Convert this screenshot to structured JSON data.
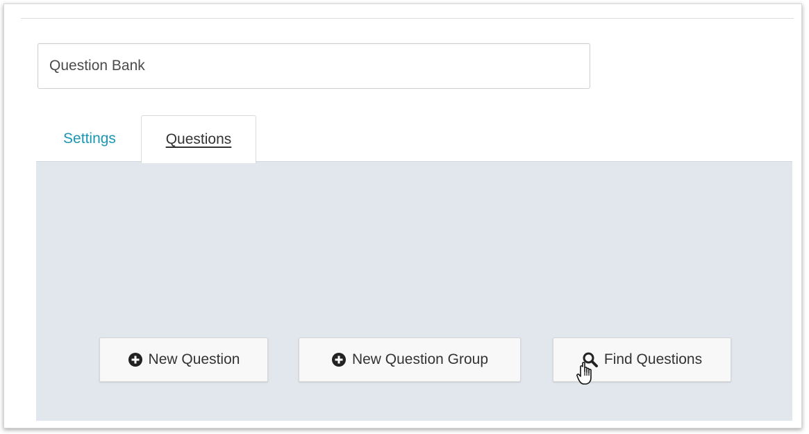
{
  "form": {
    "title_value": "Question Bank"
  },
  "tabs": [
    {
      "label": "Settings",
      "active": false
    },
    {
      "label": "Questions",
      "active": true
    }
  ],
  "actions": {
    "new_question_label": "New Question",
    "new_question_group_label": "New Question Group",
    "find_questions_label": "Find Questions"
  },
  "icons": {
    "new_question": "plus-circle-icon",
    "new_question_group": "plus-circle-icon",
    "find_questions": "search-icon",
    "pointer": "hand-pointer-cursor-icon"
  },
  "colors": {
    "tab_link": "#1a96b4",
    "panel_background": "#e1e7ed",
    "button_background": "#f8f8f8"
  }
}
